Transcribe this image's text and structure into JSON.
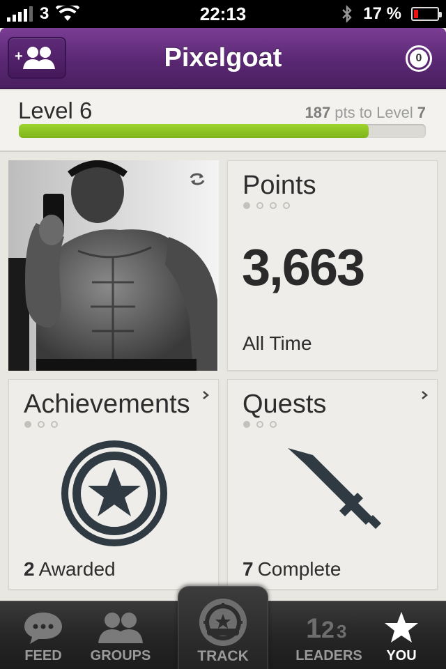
{
  "status_bar": {
    "carrier": "3",
    "time": "22:13",
    "battery_percent": "17 %",
    "battery_level": 0.17
  },
  "nav": {
    "title": "Pixelgoat",
    "notification_count": "0"
  },
  "level": {
    "label": "Level 6",
    "points_to_next": "187",
    "points_to_next_suffix": "pts to Level",
    "next_level": "7",
    "progress_fraction": 0.86
  },
  "tiles": {
    "points": {
      "title": "Points",
      "value": "3,663",
      "footer": "All Time",
      "active_dot": 0,
      "dot_count": 4
    },
    "achievements": {
      "title": "Achievements",
      "count": "2",
      "count_label": "Awarded",
      "active_dot": 0,
      "dot_count": 3
    },
    "quests": {
      "title": "Quests",
      "count": "7",
      "count_label": "Complete",
      "active_dot": 0,
      "dot_count": 3
    }
  },
  "tab_bar": {
    "feed": "FEED",
    "groups": "GROUPS",
    "track": "TRACK",
    "leaders": "LEADERS",
    "you": "YOU"
  },
  "colors": {
    "nav_purple": "#5a2873",
    "progress_green": "#8cc524",
    "tab_bar_dark": "#262626",
    "icon_slate": "#2f3a42"
  }
}
